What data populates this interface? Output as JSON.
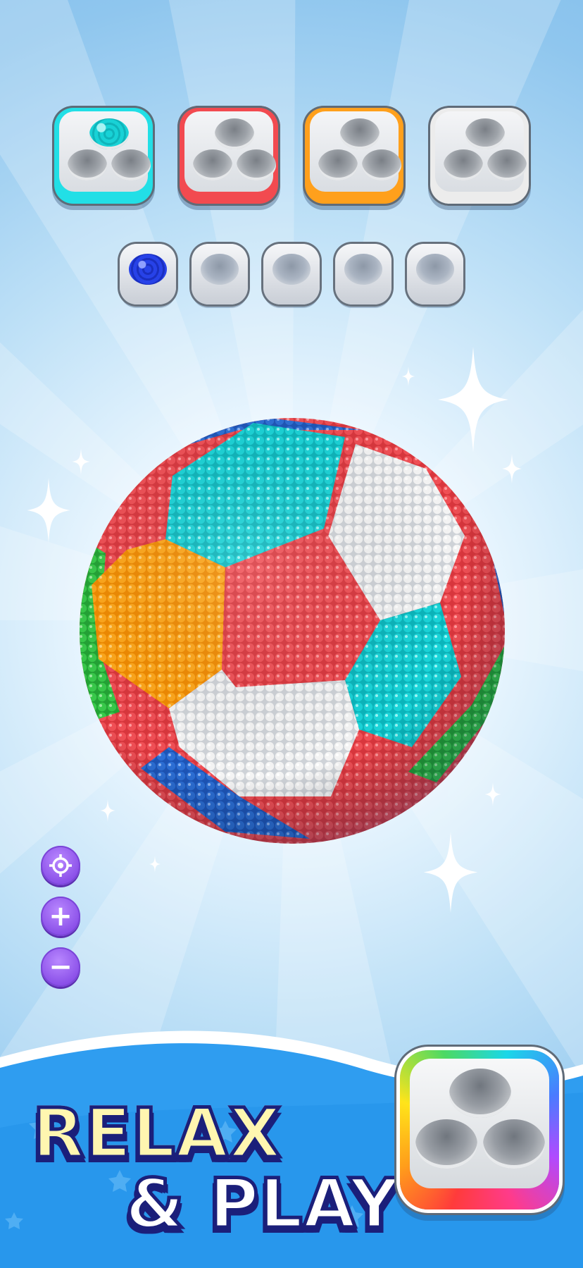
{
  "colors": {
    "cyan": "#19d4d8",
    "red": "#f04f55",
    "orange": "#ffa71a",
    "white": "#f4f4f4",
    "blue": "#2c6fd6",
    "green": "#38c94a",
    "purple": "#8a4fe8",
    "title_yellow": "#fff6b0",
    "title_outline": "#1b1f7a"
  },
  "top_trays": [
    {
      "color": "cyan",
      "fill": "#22dfe6",
      "filled_holes": 1
    },
    {
      "color": "red",
      "fill": "#f24a50",
      "filled_holes": 0
    },
    {
      "color": "orange",
      "fill": "#ffa01c",
      "filled_holes": 0
    },
    {
      "color": "white",
      "fill": "#ececec",
      "filled_holes": 0
    }
  ],
  "cups": [
    {
      "filled": true,
      "color": "blue"
    },
    {
      "filled": false
    },
    {
      "filled": false
    },
    {
      "filled": false
    },
    {
      "filled": false
    }
  ],
  "controls": [
    {
      "icon": "target-icon"
    },
    {
      "icon": "plus-icon",
      "glyph": "+"
    },
    {
      "icon": "minus-icon",
      "glyph": "−"
    }
  ],
  "tagline": {
    "line1": "RELAX",
    "line2": "& PLAY"
  },
  "big_tray": {
    "style": "rainbow"
  }
}
